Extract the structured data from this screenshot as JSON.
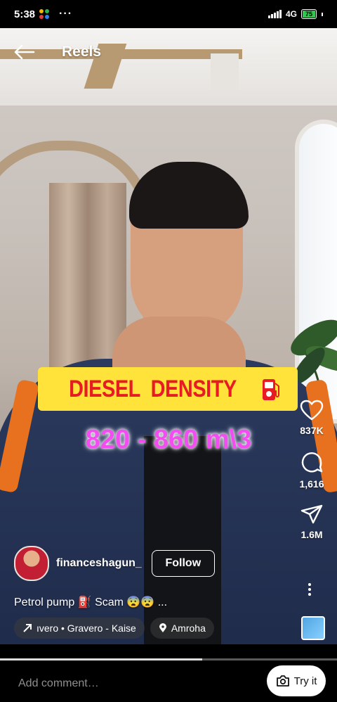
{
  "status_bar": {
    "time": "5:38",
    "more": "···",
    "network": "4G",
    "battery": "75"
  },
  "header": {
    "title": "Reels"
  },
  "overlay": {
    "banner": "DIESEL  DENSITY",
    "value": "820 - 860 m\\3"
  },
  "actions": {
    "likes": "837K",
    "comments": "1,616",
    "shares": "1.6M"
  },
  "author": {
    "username": "financeshagun_",
    "follow_label": "Follow"
  },
  "caption": "Petrol pump ⛽ Scam 😨😨 ...",
  "chips": {
    "audio": "ıvero • Gravero - Kaise",
    "location": "Amroha"
  },
  "progress": 0.6,
  "comment": {
    "placeholder": "Add comment…",
    "try_label": "Try it"
  },
  "colors": {
    "banner_bg": "#ffe23a",
    "banner_text": "#e81b25",
    "density_text": "#f34cf0",
    "battery": "#32c74e"
  }
}
